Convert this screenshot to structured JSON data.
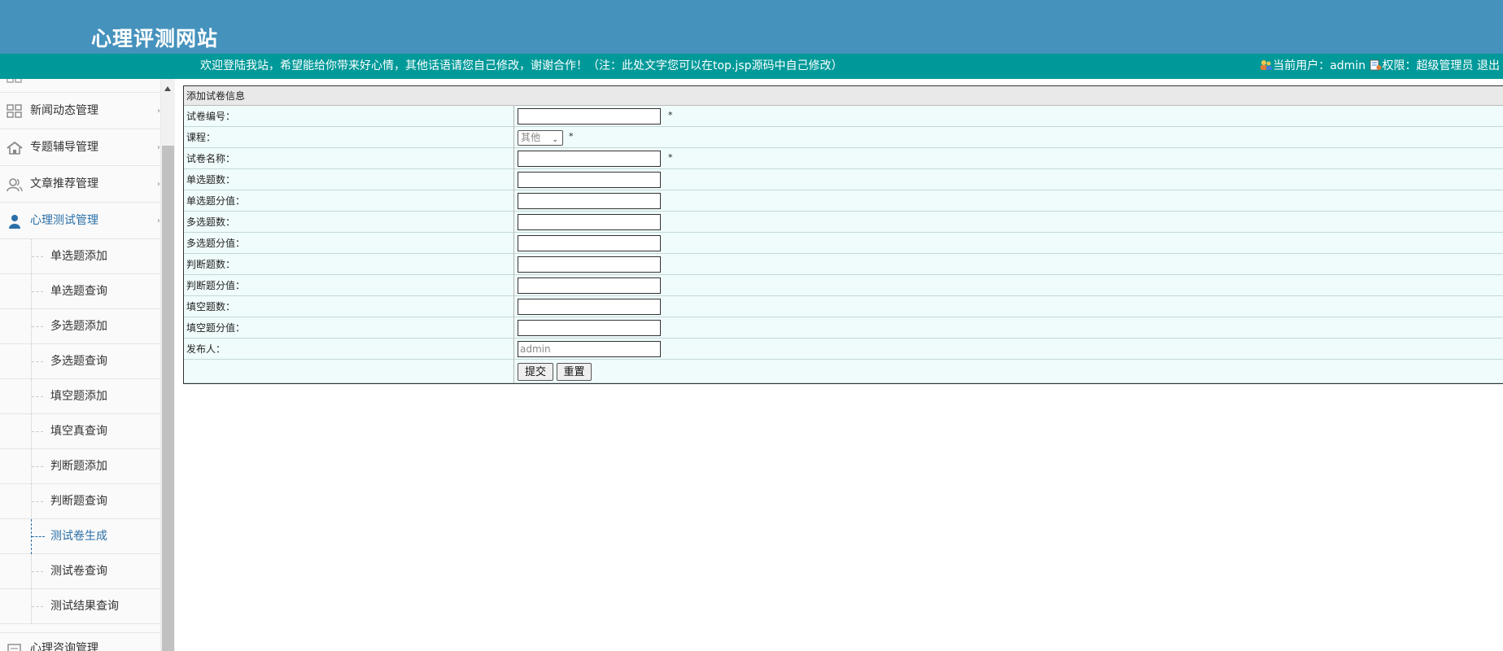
{
  "header": {
    "site_title": "心理评测网站",
    "welcome": "欢迎登陆我站，希望能给你带来好心情，其他话语请您自己修改，谢谢合作！（注：此处文字您可以在top.jsp源码中自己修改）",
    "current_user_label": "当前用户：",
    "current_user": "admin",
    "role_label": "权限：",
    "role": "超级管理员",
    "logout": "退出"
  },
  "sidebar": {
    "menus": [
      {
        "label": "新闻动态管理",
        "icon": "grid-icon"
      },
      {
        "label": "专题辅导管理",
        "icon": "home-icon"
      },
      {
        "label": "文章推荐管理",
        "icon": "users-icon"
      },
      {
        "label": "心理测试管理",
        "icon": "user-icon",
        "active": true
      }
    ],
    "sub_items": [
      {
        "label": "单选题添加"
      },
      {
        "label": "单选题查询"
      },
      {
        "label": "多选题添加"
      },
      {
        "label": "多选题查询"
      },
      {
        "label": "填空题添加"
      },
      {
        "label": "填空真查询"
      },
      {
        "label": "判断题添加"
      },
      {
        "label": "判断题查询"
      },
      {
        "label": "测试卷生成",
        "active": true
      },
      {
        "label": "测试卷查询"
      },
      {
        "label": "测试结果查询"
      }
    ],
    "tail_menu": {
      "label": "心理咨询管理",
      "icon": "doc-icon"
    }
  },
  "form": {
    "title": "添加试卷信息",
    "fields": [
      {
        "label": "试卷编号：",
        "value": "",
        "required": "*"
      },
      {
        "label": "课程：",
        "select_value": "其他",
        "required": "*"
      },
      {
        "label": "试卷名称：",
        "value": "",
        "required": "*"
      },
      {
        "label": "单选题数：",
        "value": ""
      },
      {
        "label": "单选题分值：",
        "value": ""
      },
      {
        "label": "多选题数：",
        "value": ""
      },
      {
        "label": "多选题分值：",
        "value": ""
      },
      {
        "label": "判断题数：",
        "value": ""
      },
      {
        "label": "判断题分值：",
        "value": ""
      },
      {
        "label": "填空题数：",
        "value": ""
      },
      {
        "label": "填空题分值：",
        "value": ""
      },
      {
        "label": "发布人：",
        "value": "admin"
      }
    ],
    "submit_label": "提交",
    "reset_label": "重置"
  },
  "colors": {
    "header_bg": "#4592bd",
    "welcome_bar_bg": "#009999",
    "active_link": "#2a6fa8",
    "row_bg": "#f0fbfb"
  }
}
